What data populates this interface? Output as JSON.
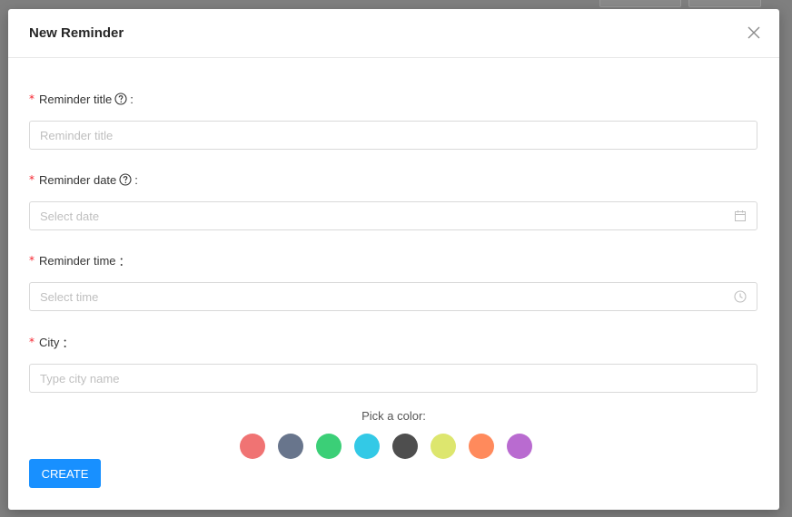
{
  "modal": {
    "title": "New Reminder",
    "close_icon": "close-icon"
  },
  "form": {
    "required_mark": "*",
    "title_field": {
      "label": "Reminder title",
      "colon": ":",
      "placeholder": "Reminder title",
      "help_icon": "question-circle-icon"
    },
    "date_field": {
      "label": "Reminder date",
      "colon": ":",
      "placeholder": "Select date",
      "help_icon": "question-circle-icon",
      "suffix_icon": "calendar-icon"
    },
    "time_field": {
      "label": "Reminder time",
      "colon": "：",
      "placeholder": "Select time",
      "suffix_icon": "clock-icon"
    },
    "city_field": {
      "label": "City",
      "colon": "：",
      "placeholder": "Type city name"
    }
  },
  "color_picker": {
    "label": "Pick a color:",
    "colors": [
      "#f07373",
      "#68758c",
      "#3bcf77",
      "#33c9e6",
      "#4e4e4e",
      "#dde66e",
      "#ff8a5c",
      "#b96bd0"
    ]
  },
  "actions": {
    "create_label": "CREATE"
  }
}
